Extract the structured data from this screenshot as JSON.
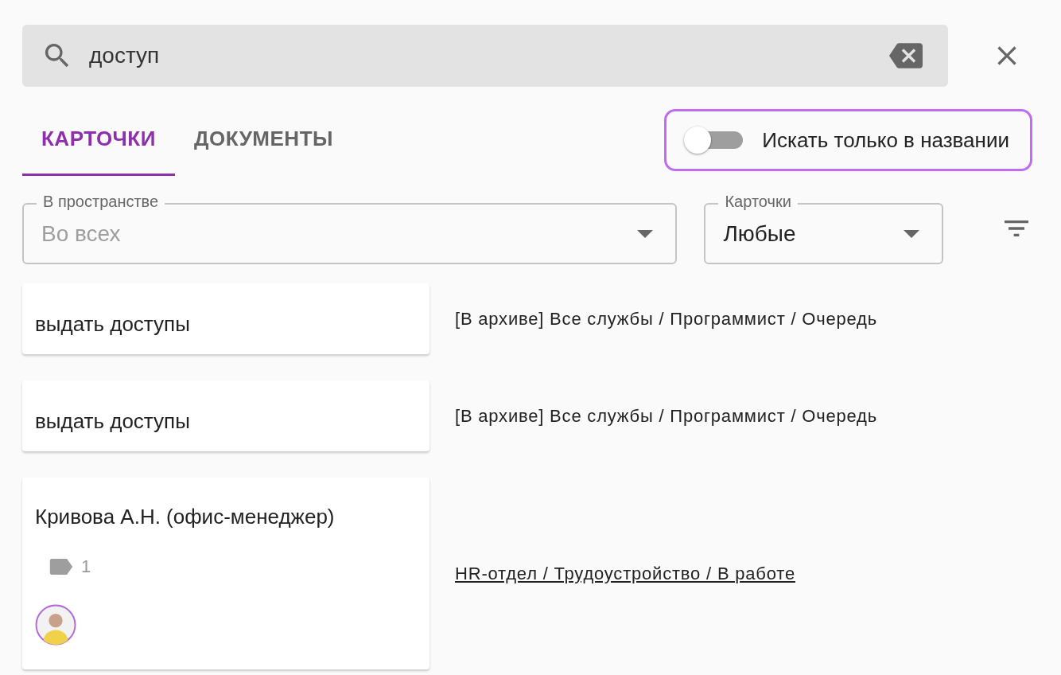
{
  "search": {
    "value": "доступ"
  },
  "tabs": [
    {
      "label": "КАРТОЧКИ",
      "selected": true
    },
    {
      "label": "ДОКУМЕНТЫ",
      "selected": false
    }
  ],
  "title_only_toggle": {
    "label": "Искать только в названии",
    "on": false,
    "focused": true
  },
  "filters": [
    {
      "label": "В пространстве",
      "value": "Во всех",
      "disabled": true
    },
    {
      "label": "Карточки",
      "value": "Любые",
      "disabled": false
    }
  ],
  "results": [
    {
      "title": "выдать доступы",
      "path": "[В архиве] Все службы / Программист / Очередь",
      "underlined": false
    },
    {
      "title": "выдать доступы",
      "path": "[В архиве] Все службы / Программист / Очередь",
      "underlined": false
    },
    {
      "title": "Кривова А.Н. (офис-менеджер)",
      "tag_count": "1",
      "avatar": true,
      "path": "HR-отдел / Трудоустройство / В работе",
      "underlined": true
    }
  ]
}
